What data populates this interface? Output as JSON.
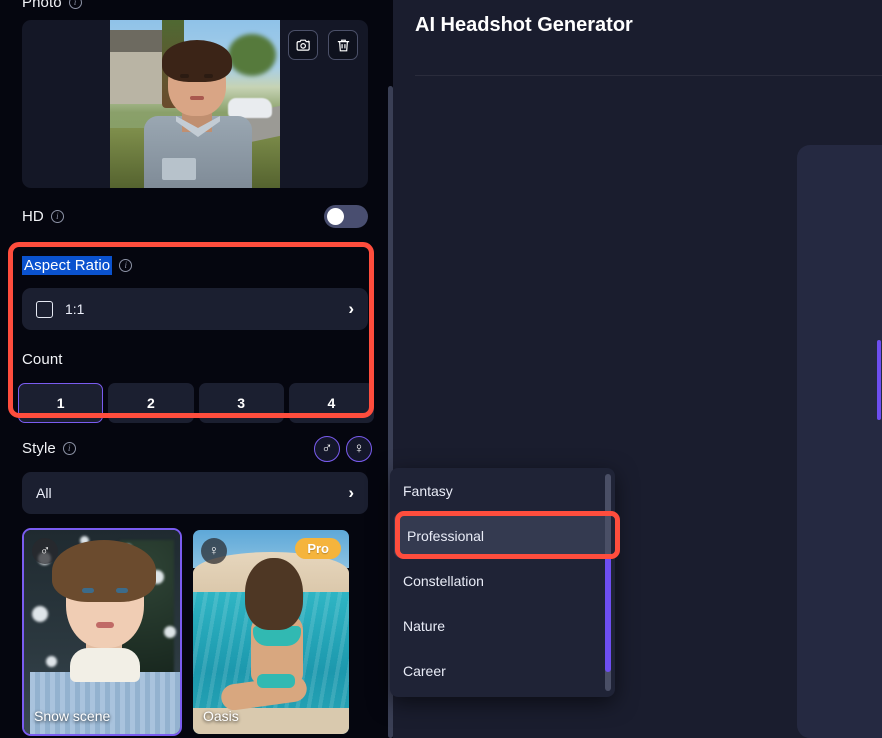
{
  "app": {
    "title": "AI Headshot Generator"
  },
  "sidebar": {
    "photo": {
      "label": "Photo",
      "info_icon": "info-icon",
      "retake_icon": "camera-icon",
      "delete_icon": "trash-icon"
    },
    "hd": {
      "label": "HD",
      "info_icon": "info-icon",
      "toggle_state": "off"
    },
    "aspect_ratio": {
      "label": "Aspect Ratio",
      "info_icon": "info-icon",
      "value": "1:1",
      "value_icon": "square-icon",
      "chevron": "chevron-right-icon",
      "selected_text": true
    },
    "count": {
      "label": "Count",
      "options": [
        "1",
        "2",
        "3",
        "4"
      ],
      "selected": "1"
    },
    "style": {
      "label": "Style",
      "info_icon": "info-icon",
      "gender_buttons": [
        {
          "name": "male-filter",
          "glyph": "♂"
        },
        {
          "name": "female-filter",
          "glyph": "♀"
        }
      ],
      "filter_value": "All",
      "chevron": "chevron-right-icon",
      "thumbnails": [
        {
          "caption": "Snow scene",
          "badge_glyph": "♂",
          "badge_name": "male-badge",
          "pro": false,
          "selected": true
        },
        {
          "caption": "Oasis",
          "badge_glyph": "♀",
          "badge_name": "female-badge",
          "pro": true,
          "pro_label": "Pro",
          "selected": false
        }
      ]
    }
  },
  "dropdown": {
    "name": "style-category-dropdown",
    "items": [
      {
        "label": "Fantasy",
        "highlighted": false
      },
      {
        "label": "Professional",
        "highlighted": true
      },
      {
        "label": "Constellation",
        "highlighted": false
      },
      {
        "label": "Nature",
        "highlighted": false
      },
      {
        "label": "Career",
        "highlighted": false
      }
    ]
  },
  "annotations": {
    "highlight_color": "#ff4d3d",
    "accent_color": "#7a5cf0",
    "selection_color": "#0a52cf",
    "pro_badge_color": "#f5b43c"
  }
}
